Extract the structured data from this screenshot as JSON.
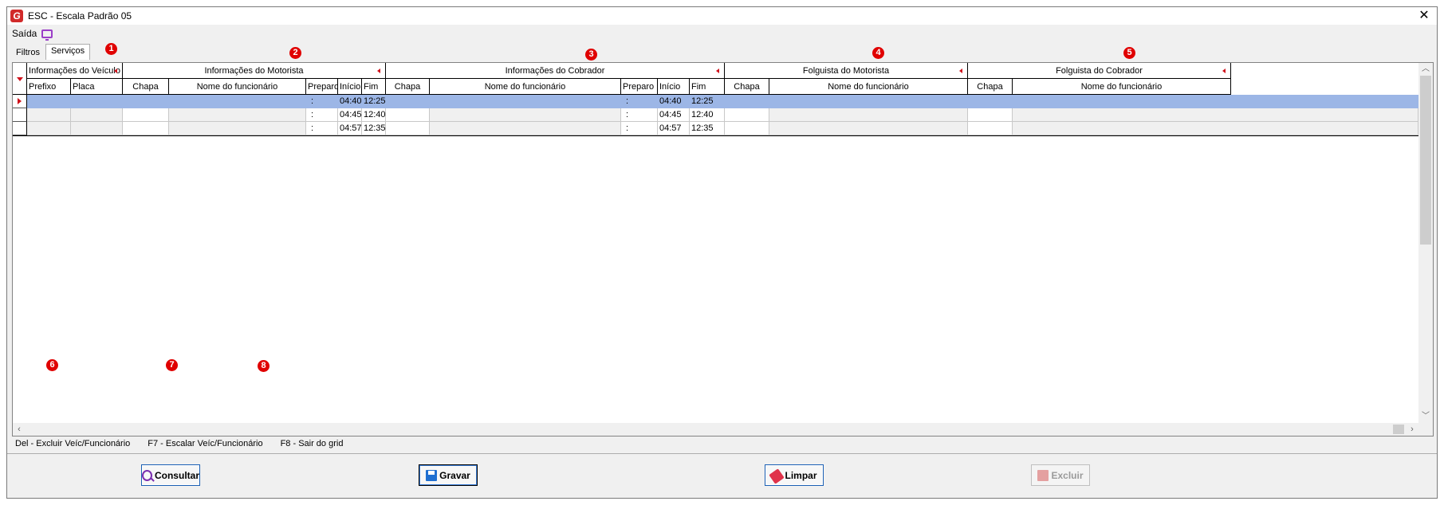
{
  "window": {
    "title": "ESC - Escala Padrão 05",
    "icon": "app-logo-icon"
  },
  "menu": {
    "saida": "Saída"
  },
  "tabs": [
    {
      "label": "Filtros"
    },
    {
      "label": "Serviços"
    }
  ],
  "grid": {
    "groups": {
      "veiculo": "Informações do Veículo",
      "motorista": "Informações do Motorista",
      "cobrador": "Informações do Cobrador",
      "folg_motorista": "Folguista do Motorista",
      "folg_cobrador": "Folguista do Cobrador"
    },
    "columns": {
      "prefixo": "Prefixo",
      "placa": "Placa",
      "chapa": "Chapa",
      "nome": "Nome do funcionário",
      "preparo": "Preparo",
      "inicio": "Início",
      "fim": "Fim"
    },
    "rows": [
      {
        "m_preparo": ":",
        "m_inicio": "04:40",
        "m_fim": "12:25",
        "c_preparo": ":",
        "c_inicio": "04:40",
        "c_fim": "12:25"
      },
      {
        "m_preparo": ":",
        "m_inicio": "04:45",
        "m_fim": "12:40",
        "c_preparo": ":",
        "c_inicio": "04:45",
        "c_fim": "12:40"
      },
      {
        "m_preparo": ":",
        "m_inicio": "04:57",
        "m_fim": "12:35",
        "c_preparo": ":",
        "c_inicio": "04:57",
        "c_fim": "12:35"
      }
    ]
  },
  "shortcuts": {
    "del": "Del - Excluir Veíc/Funcionário",
    "f7": "F7 - Escalar Veíc/Funcionário",
    "f8": "F8 - Sair do grid"
  },
  "buttons": {
    "consultar": "Consultar",
    "gravar": "Gravar",
    "limpar": "Limpar",
    "excluir": "Excluir"
  },
  "badges": [
    "1",
    "2",
    "3",
    "4",
    "5",
    "6",
    "7",
    "8"
  ],
  "colors": {
    "selection": "#9cb6e6",
    "badge": "#e00000",
    "accent_red": "#d0111b"
  }
}
